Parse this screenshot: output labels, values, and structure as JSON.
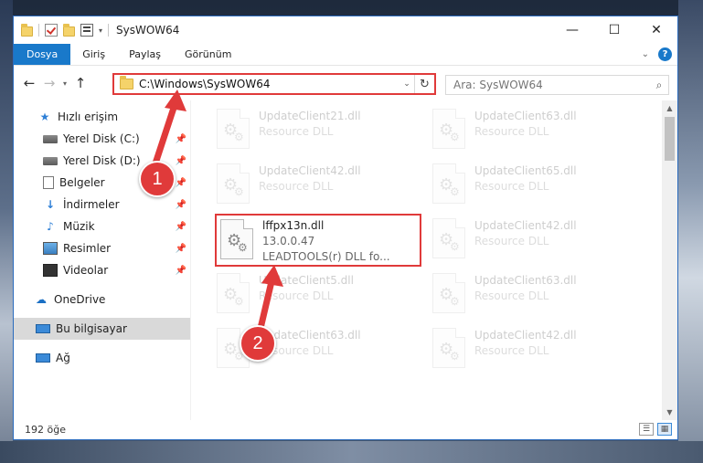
{
  "window": {
    "title": "SysWOW64",
    "minimize_glyph": "—",
    "maximize_glyph": "☐",
    "close_glyph": "✕"
  },
  "ribbon": {
    "tabs": [
      "Dosya",
      "Giriş",
      "Paylaş",
      "Görünüm"
    ],
    "file_tab_color": "#1979ca",
    "help_label": "?"
  },
  "address": {
    "path": "C:\\Windows\\SysWOW64",
    "search_placeholder": "Ara: SysWOW64"
  },
  "nav": {
    "items": [
      {
        "label": "Hızlı erişim",
        "icon": "star-icon",
        "pinned": false
      },
      {
        "label": "Yerel Disk (C:)",
        "icon": "drive-icon",
        "pinned": true
      },
      {
        "label": "Yerel Disk (D:)",
        "icon": "drive-icon",
        "pinned": true
      },
      {
        "label": "Belgeler",
        "icon": "documents-icon",
        "pinned": true
      },
      {
        "label": "İndirmeler",
        "icon": "download-icon",
        "pinned": true
      },
      {
        "label": "Müzik",
        "icon": "music-icon",
        "pinned": true
      },
      {
        "label": "Resimler",
        "icon": "pictures-icon",
        "pinned": true
      },
      {
        "label": "Videolar",
        "icon": "videos-icon",
        "pinned": true
      },
      {
        "label": "OneDrive",
        "icon": "cloud-icon",
        "pinned": false
      },
      {
        "label": "Bu bilgisayar",
        "icon": "pc-icon",
        "pinned": false,
        "selected": true
      },
      {
        "label": "Ağ",
        "icon": "network-icon",
        "pinned": false
      }
    ]
  },
  "files": [
    {
      "name": "UpdateClient21.dll",
      "line2": "Resource DLL",
      "line3": "",
      "faded": true
    },
    {
      "name": "UpdateClient63.dll",
      "line2": "Resource DLL",
      "line3": "",
      "faded": true
    },
    {
      "name": "UpdateClient42.dll",
      "line2": "Resource DLL",
      "line3": "",
      "faded": true
    },
    {
      "name": "UpdateClient65.dll",
      "line2": "Resource DLL",
      "line3": "",
      "faded": true
    },
    {
      "name": "lffpx13n.dll",
      "line2": "13.0.0.47",
      "line3": "LEADTOOLS(r) DLL fo...",
      "faded": false,
      "highlighted": true
    },
    {
      "name": "UpdateClient42.dll",
      "line2": "Resource DLL",
      "line3": "",
      "faded": true
    },
    {
      "name": "UpdateClient5.dll",
      "line2": "Resource DLL",
      "line3": "",
      "faded": true
    },
    {
      "name": "UpdateClient63.dll",
      "line2": "Resource DLL",
      "line3": "",
      "faded": true
    },
    {
      "name": "UpdateClient63.dll",
      "line2": "Resource DLL",
      "line3": "",
      "faded": true
    },
    {
      "name": "UpdateClient42.dll",
      "line2": "Resource DLL",
      "line3": "",
      "faded": true
    }
  ],
  "status": {
    "item_count": "192 öğe"
  },
  "callouts": {
    "step1": "1",
    "step2": "2",
    "color": "#e03a3a"
  }
}
